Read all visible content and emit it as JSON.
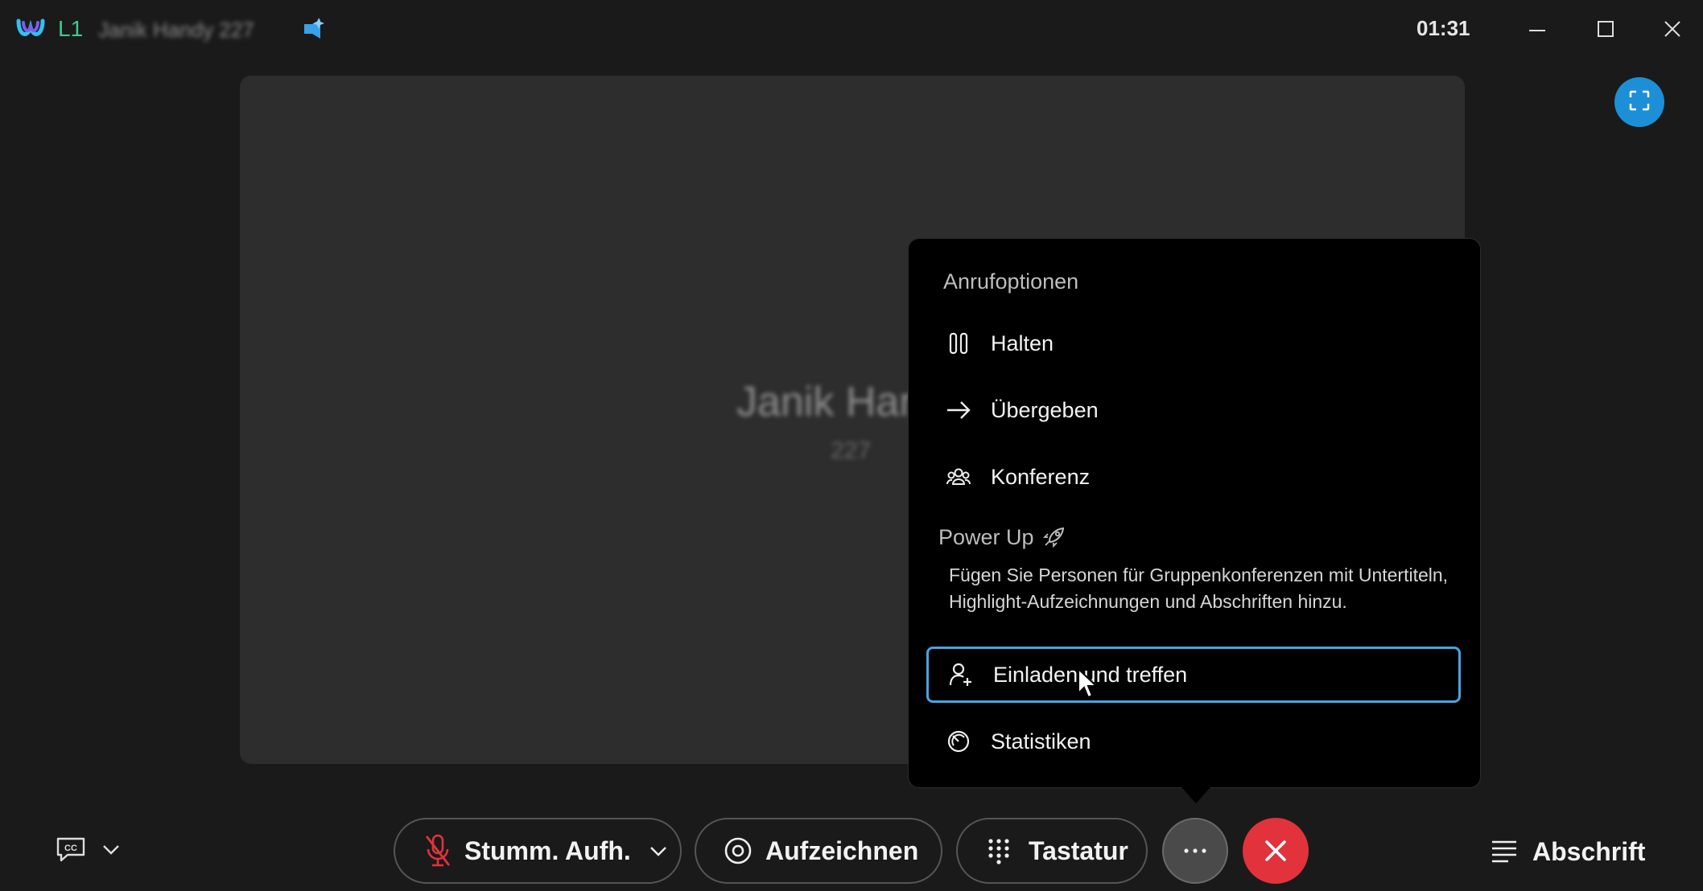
{
  "titlebar": {
    "line": "L1",
    "caller": "Janik Handy 227",
    "timer": "01:31"
  },
  "participant": {
    "name": "Janik Handy",
    "number": "227"
  },
  "menu": {
    "heading_call_options": "Anrufoptionen",
    "hold": "Halten",
    "transfer": "Übergeben",
    "conference": "Konferenz",
    "heading_power_up": "Power Up",
    "power_up_description": "Fügen Sie Personen für Gruppenkonferenzen mit Untertiteln, Highlight-Aufzeichnungen und Abschriften hinzu.",
    "invite_meet": "Einladen und treffen",
    "statistics": "Statistiken"
  },
  "controls": {
    "mute": "Stumm. Aufh.",
    "record": "Aufzeichnen",
    "keypad": "Tastatur",
    "transcript": "Abschrift"
  },
  "colors": {
    "accent_blue": "#1d8fd6",
    "end_call_red": "#e2323c",
    "focus_ring": "#4aa3e0",
    "line_green": "#3fc98f"
  }
}
